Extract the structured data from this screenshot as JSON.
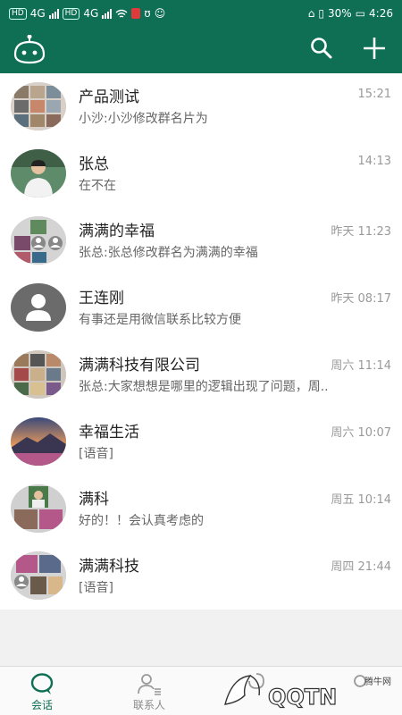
{
  "status": {
    "net1": "4G",
    "net2": "4G",
    "battery": "30%",
    "time": "4:26"
  },
  "tabs": [
    {
      "label": "会话"
    },
    {
      "label": "联系人"
    },
    {
      "label": ""
    },
    {
      "label": ""
    }
  ],
  "conversations": [
    {
      "name": "产品测试",
      "time": "15:21",
      "msg": "小沙:小沙修改群名片为"
    },
    {
      "name": "张总",
      "time": "14:13",
      "msg": "在不在"
    },
    {
      "name": "满满的幸福",
      "time": "昨天 11:23",
      "msg": "张总:张总修改群名为满满的幸福"
    },
    {
      "name": "王连刚",
      "time": "昨天 08:17",
      "msg": "有事还是用微信联系比较方便"
    },
    {
      "name": "满满科技有限公司",
      "time": "周六 11:14",
      "msg": "张总:大家想想是哪里的逻辑出现了问题，周.."
    },
    {
      "name": "幸福生活",
      "time": "周六 10:07",
      "msg": "[语音]"
    },
    {
      "name": "满科",
      "time": "周五 10:14",
      "msg": "好的！！会认真考虑的"
    },
    {
      "name": "满满科技",
      "time": "周四 21:44",
      "msg": "[语音]"
    }
  ],
  "watermark": "腾牛网",
  "colors": {
    "primary": "#0e6f55",
    "background": "#f1f1f1"
  }
}
